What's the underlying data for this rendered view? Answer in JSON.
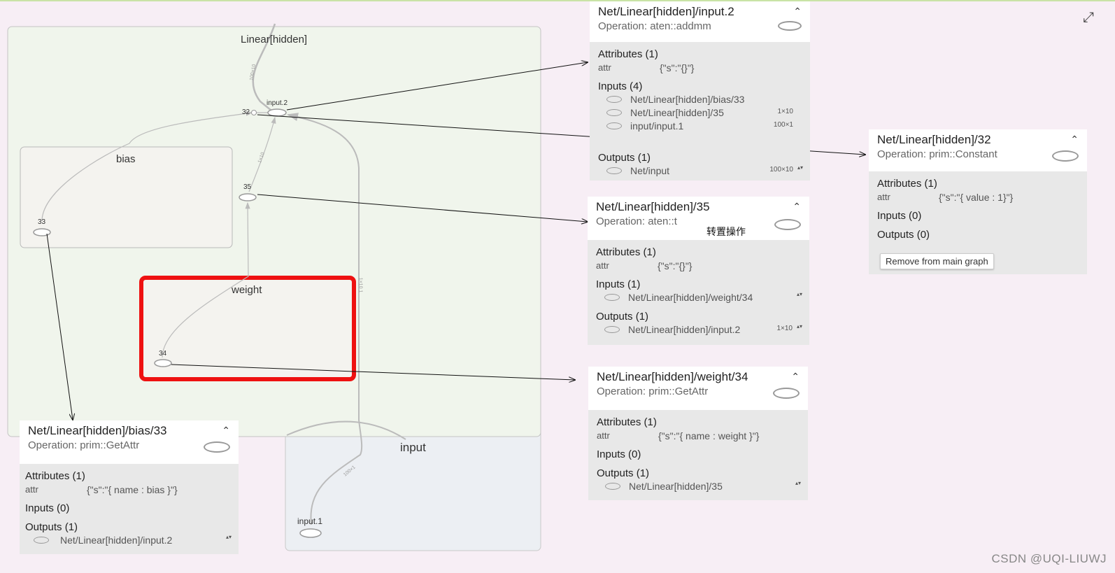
{
  "graph": {
    "scope_linear": "Linear[hidden]",
    "scope_bias": "bias",
    "scope_weight": "weight",
    "scope_input": "input",
    "nodes": {
      "n32": "32",
      "n33": "33",
      "n34": "34",
      "n35": "35",
      "input2": "input.2",
      "input1": "input.1"
    },
    "edge_labels": {
      "e_top": "100×10",
      "e_35": "1×10",
      "e_right": "1×10 1",
      "e_input": "100×1"
    },
    "annotation": "转置操作"
  },
  "cards": {
    "input2": {
      "title": "Net/Linear[hidden]/input.2",
      "operation": "Operation: aten::addmm",
      "attributes_header": "Attributes (1)",
      "attr_key": "attr",
      "attr_value": "{\"s\":\"{}\"}",
      "inputs_header": "Inputs (4)",
      "inputs": [
        {
          "name": "Net/Linear[hidden]/bias/33",
          "size": ""
        },
        {
          "name": "Net/Linear[hidden]/35",
          "size": "1×10"
        },
        {
          "name": "input/input.1",
          "size": "100×1"
        }
      ],
      "outputs_header": "Outputs (1)",
      "outputs": [
        {
          "name": "Net/input",
          "size": "100×10"
        }
      ]
    },
    "n32": {
      "title": "Net/Linear[hidden]/32",
      "operation": "Operation: prim::Constant",
      "attributes_header": "Attributes (1)",
      "attr_key": "attr",
      "attr_value": "{\"s\":\"{ value : 1}\"}",
      "inputs_header": "Inputs (0)",
      "outputs_header": "Outputs (0)",
      "remove_button": "Remove from main graph"
    },
    "n35": {
      "title": "Net/Linear[hidden]/35",
      "operation": "Operation: aten::t",
      "attributes_header": "Attributes (1)",
      "attr_key": "attr",
      "attr_value": "{\"s\":\"{}\"}",
      "inputs_header": "Inputs (1)",
      "inputs": [
        {
          "name": "Net/Linear[hidden]/weight/34",
          "size": ""
        }
      ],
      "outputs_header": "Outputs (1)",
      "outputs": [
        {
          "name": "Net/Linear[hidden]/input.2",
          "size": "1×10"
        }
      ]
    },
    "weight34": {
      "title": "Net/Linear[hidden]/weight/34",
      "operation": "Operation: prim::GetAttr",
      "attributes_header": "Attributes (1)",
      "attr_key": "attr",
      "attr_value": "{\"s\":\"{ name : weight }\"}",
      "inputs_header": "Inputs (0)",
      "outputs_header": "Outputs (1)",
      "outputs": [
        {
          "name": "Net/Linear[hidden]/35",
          "size": ""
        }
      ]
    },
    "bias33": {
      "title": "Net/Linear[hidden]/bias/33",
      "operation": "Operation: prim::GetAttr",
      "attributes_header": "Attributes (1)",
      "attr_key": "attr",
      "attr_value": "{\"s\":\"{ name : bias }\"}",
      "inputs_header": "Inputs (0)",
      "outputs_header": "Outputs (1)",
      "outputs": [
        {
          "name": "Net/Linear[hidden]/input.2",
          "size": ""
        }
      ]
    }
  },
  "icons": {
    "caret": "chevron-up-icon",
    "expand": "expand-icon",
    "spinner": "spinner-icon"
  },
  "symbols": {
    "caret": "⌃",
    "expand": "⤢",
    "spin": "▴▾"
  },
  "watermark": "CSDN @UQI-LIUWJ"
}
